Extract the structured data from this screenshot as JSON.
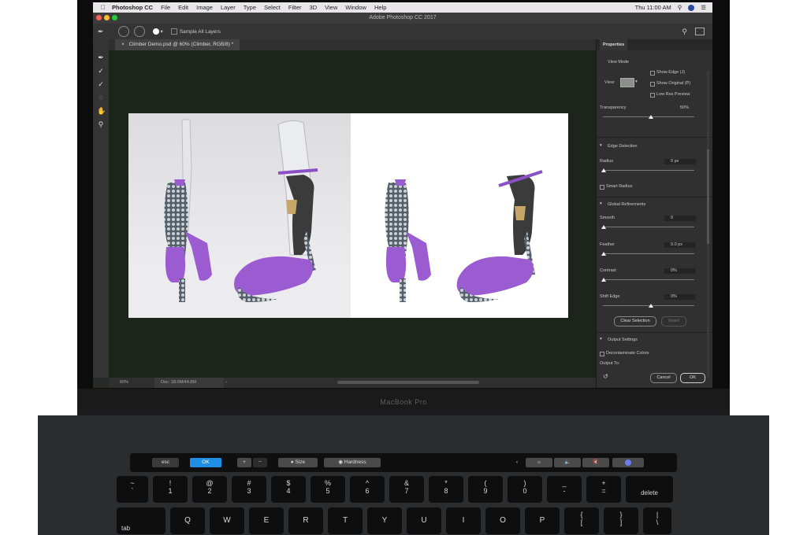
{
  "menubar": {
    "items": [
      "Photoshop CC",
      "File",
      "Edit",
      "Image",
      "Layer",
      "Type",
      "Select",
      "Filter",
      "3D",
      "View",
      "Window",
      "Help"
    ],
    "clock": "Thu 11:00 AM"
  },
  "window": {
    "title": "Adobe Photoshop CC 2017"
  },
  "options": {
    "sample_all_layers": "Sample All Layers"
  },
  "document": {
    "tab": "Climber Demo.psd @ 60% (Climber, RGB/8) *"
  },
  "status": {
    "zoom": "60%",
    "doc": "Doc: 18.0M/44.8M"
  },
  "properties": {
    "title": "Properties",
    "view_mode": "View Mode",
    "view_label": "View:",
    "show_edge": "Show Edge (J)",
    "show_original": "Show Original (P)",
    "high_res": "Low Res Preview",
    "transparency_label": "Transparency",
    "transparency_value": "50%",
    "transparency_level": 0.5,
    "edge_detection": "Edge Detection",
    "radius_label": "Radius",
    "radius_value": "0 px",
    "smart_radius": "Smart Radius",
    "global_refinements": "Global Refinements",
    "smooth_label": "Smooth",
    "smooth_value": "0",
    "feather_label": "Feather",
    "feather_value": "0.0 px",
    "contrast_label": "Contrast",
    "contrast_value": "0%",
    "shift_edge_label": "Shift Edge",
    "shift_edge_value": "0%",
    "clear_selection": "Clear Selection",
    "invert": "Invert",
    "output_settings": "Output Settings",
    "decontaminate": "Decontaminate Colors",
    "output_to": "Output To:",
    "cancel": "Cancel",
    "ok": "OK"
  },
  "laptop": {
    "model": "MacBook Pro"
  },
  "touchbar": {
    "esc": "esc",
    "ok": "OK",
    "size": "Size",
    "hardness": "Hardness"
  },
  "keys": {
    "row1": [
      {
        "top": "~",
        "bottom": "`"
      },
      {
        "top": "!",
        "bottom": "1"
      },
      {
        "top": "@",
        "bottom": "2"
      },
      {
        "top": "#",
        "bottom": "3"
      },
      {
        "top": "$",
        "bottom": "4"
      },
      {
        "top": "%",
        "bottom": "5"
      },
      {
        "top": "^",
        "bottom": "6"
      },
      {
        "top": "&",
        "bottom": "7"
      },
      {
        "top": "*",
        "bottom": "8"
      },
      {
        "top": "(",
        "bottom": "9"
      },
      {
        "top": ")",
        "bottom": "0"
      },
      {
        "top": "_",
        "bottom": "-"
      },
      {
        "top": "+",
        "bottom": "="
      }
    ],
    "delete": "delete",
    "tab": "tab",
    "row2": [
      "Q",
      "W",
      "E",
      "R",
      "T",
      "Y",
      "U",
      "I",
      "O",
      "P"
    ],
    "brackets": [
      {
        "top": "{",
        "bottom": "["
      },
      {
        "top": "}",
        "bottom": "]"
      },
      {
        "top": "|",
        "bottom": "\\"
      }
    ]
  },
  "colors": {
    "accent": "#1f8fe6",
    "shoe_purple": "#9b5bd1"
  }
}
